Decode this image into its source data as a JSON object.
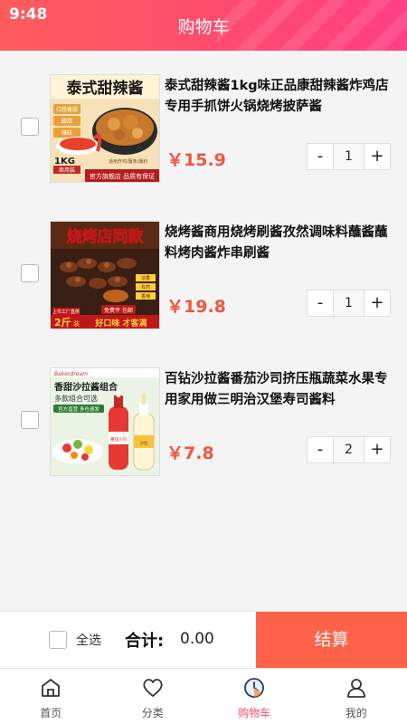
{
  "status_bar": {
    "time": "9:48"
  },
  "header": {
    "title": "购物车"
  },
  "cart": {
    "items": [
      {
        "title": "泰式甜辣酱1kg味正品康甜辣酱炸鸡店专用手抓饼火锅烧烤披萨酱",
        "price": "￥15.9",
        "quantity": "1",
        "image": {
          "headline": "泰式甜辣酱",
          "tags": [
            "口感香甜",
            "酸甜",
            "辣味"
          ],
          "weight": "1KG",
          "pack": "商用装",
          "note": "适用炸鸡/薯条/蘸料",
          "banner": "官方旗舰店 品质有保证"
        }
      },
      {
        "title": "烧烤酱商用烧烤刷酱孜然调味料蘸酱蘸料烤肉酱炸串刷酱",
        "price": "￥19.8",
        "quantity": "1",
        "image": {
          "headline": "烧烤店同款",
          "corner": "上市工厂直供",
          "weight": "2斤",
          "pack": "装",
          "badge": "免费平 包邮",
          "tags": [
            "浓香",
            "孜然",
            "香辣"
          ],
          "banner": "好口味 才客满"
        }
      },
      {
        "title": "百钻沙拉酱番茄沙司挤压瓶蔬菜水果专用家用做三明治汉堡寿司酱料",
        "price": "￥7.8",
        "quantity": "2",
        "image": {
          "brand": "Bakerdream",
          "headline": "香甜沙拉酱组合",
          "sub": "多款组合可选",
          "tag": "官方直营 多仓速发",
          "bottle_label": "番茄沙司",
          "bottle_label_2": "沙拉"
        }
      }
    ]
  },
  "checkout": {
    "select_all": "全选",
    "total_label": "合计:",
    "total_value": "0.00",
    "button": "结算"
  },
  "tabbar": {
    "tabs": [
      {
        "label": "首页",
        "icon": "home-icon",
        "active": false
      },
      {
        "label": "分类",
        "icon": "heart-icon",
        "active": false
      },
      {
        "label": "购物车",
        "icon": "cart-clock-icon",
        "active": true
      },
      {
        "label": "我的",
        "icon": "user-icon",
        "active": false
      }
    ]
  },
  "colors": {
    "header_gradient_start": "#ff5c5c",
    "header_gradient_end": "#ff3f86",
    "price": "#f2553d",
    "checkout_button": "#ff6249",
    "active_tab": "#ff4d6a"
  }
}
